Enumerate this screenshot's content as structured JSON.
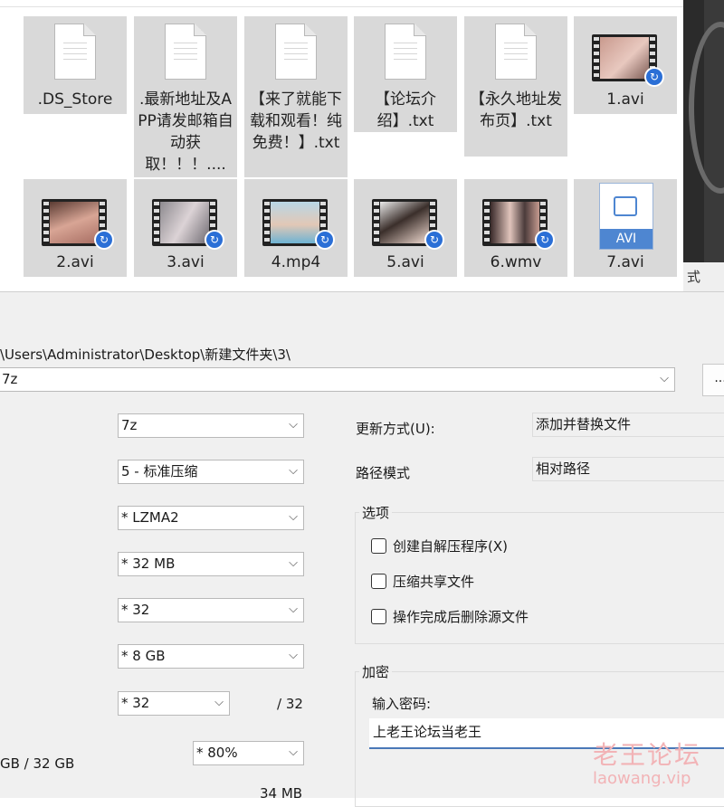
{
  "explorer": {
    "files": [
      {
        "name": ".DS_Store",
        "type": "doc"
      },
      {
        "name": ".最新地址及APP请发邮箱自动获取！！！....",
        "type": "doc"
      },
      {
        "name": "【来了就能下载和观看！纯免费！】.txt",
        "type": "doc"
      },
      {
        "name": "【论坛介绍】.txt",
        "type": "doc"
      },
      {
        "name": "【永久地址发布页】.txt",
        "type": "doc"
      },
      {
        "name": "1.avi",
        "type": "video"
      },
      {
        "name": "2.avi",
        "type": "video"
      },
      {
        "name": "3.avi",
        "type": "video"
      },
      {
        "name": "4.mp4",
        "type": "video"
      },
      {
        "name": "5.avi",
        "type": "video"
      },
      {
        "name": "6.wmv",
        "type": "video"
      },
      {
        "name": "7.avi",
        "type": "avi-doc",
        "badge": "AVI"
      }
    ]
  },
  "side_strip": {
    "text": "式"
  },
  "dialog": {
    "archive_path": "\\Users\\Administrator\\Desktop\\新建文件夹\\3\\",
    "archive_name": "7z",
    "more_button": "...",
    "left_fields": [
      {
        "value": "7z"
      },
      {
        "value": "5 - 标准压缩"
      },
      {
        "value": "*  LZMA2"
      },
      {
        "value": "*  32 MB"
      },
      {
        "value": "*  32"
      },
      {
        "value": "*  8 GB"
      },
      {
        "value": "*  32"
      }
    ],
    "threads_max": "/ 32",
    "memory_label": "GB / 32 GB",
    "memory_value": "*  80%",
    "memory_usage": "34 MB",
    "update_mode_label": "更新方式(U):",
    "update_mode_value": "添加并替换文件",
    "path_mode_label": "路径模式",
    "path_mode_value": "相对路径",
    "options_title": "选项",
    "options": [
      {
        "label": "创建自解压程序(X)",
        "checked": false
      },
      {
        "label": "压缩共享文件",
        "checked": false
      },
      {
        "label": "操作完成后删除源文件",
        "checked": false
      }
    ],
    "encryption_title": "加密",
    "password_label": "输入密码:",
    "password_value": "上老王论坛当老王"
  },
  "watermark": {
    "line1": "老王论坛",
    "line2": "laowang.vip"
  },
  "colors": {
    "accent": "#4a78b8",
    "tile_bg": "#d9d9d9",
    "dialog_bg": "#f0f0f0",
    "watermark": "#f2b3b6"
  }
}
